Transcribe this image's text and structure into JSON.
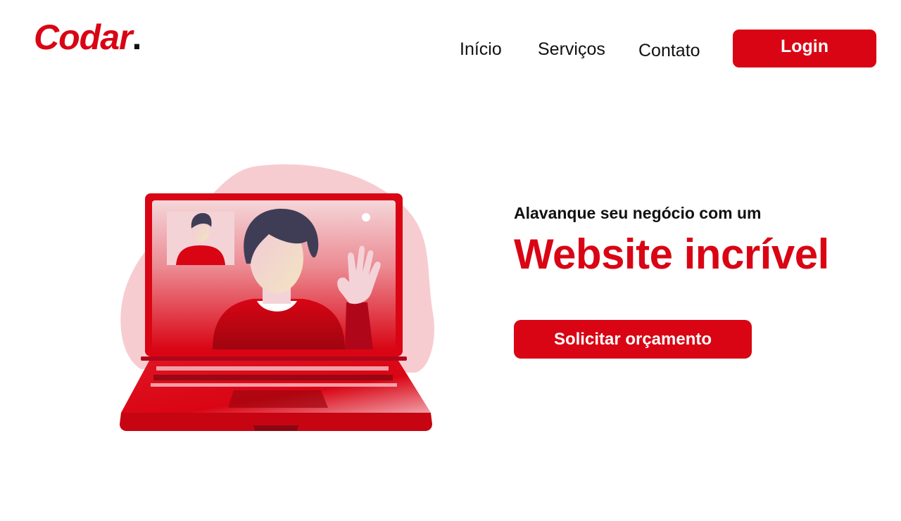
{
  "brand": {
    "name": "Codar",
    "dot": ".",
    "accent_color": "#d90514"
  },
  "nav": {
    "items": [
      {
        "label": "Início"
      },
      {
        "label": "Serviços"
      },
      {
        "label": "Contato"
      }
    ],
    "login_label": "Login"
  },
  "hero": {
    "tagline": "Alavanque seu negócio com um",
    "headline": "Website incrível",
    "cta_label": "Solicitar orçamento",
    "illustration": "laptop-video-call-illustration"
  }
}
